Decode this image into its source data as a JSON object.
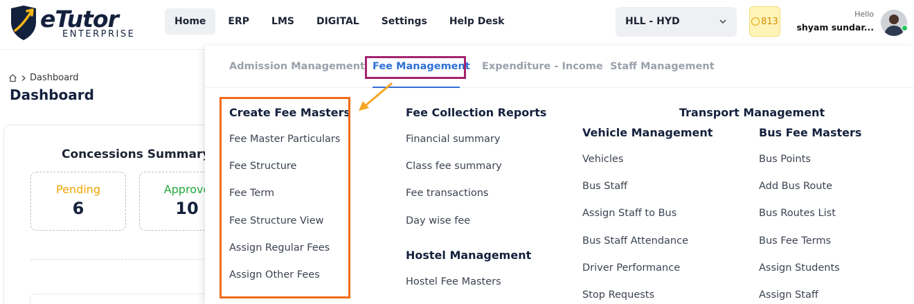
{
  "header": {
    "logo_text": "eTutor",
    "logo_sub": "ENTERPRISE",
    "nav": [
      {
        "label": "Home",
        "active": true
      },
      {
        "label": "ERP",
        "active": false
      },
      {
        "label": "LMS",
        "active": false
      },
      {
        "label": "DIGITAL",
        "active": false
      },
      {
        "label": "Settings",
        "active": false
      },
      {
        "label": "Help Desk",
        "active": false
      }
    ],
    "branch": "HLL - HYD",
    "coins": "813",
    "greeting": "Hello",
    "user_name": "shyam sundar..."
  },
  "page": {
    "breadcrumb": "Dashboard",
    "title": "Dashboard",
    "card_title": "Concessions Summary",
    "stats": [
      {
        "label": "Pending",
        "value": "6",
        "color": "#f0a500"
      },
      {
        "label": "Approve",
        "value": "10",
        "color": "#22a83a"
      }
    ]
  },
  "menu": {
    "tabs": [
      "Admission Management",
      "Fee Management",
      "Expenditure - Income",
      "Staff Management"
    ],
    "active_tab": "Fee Management",
    "col1": {
      "heading": "Create Fee Masters",
      "links": [
        "Fee Master Particulars",
        "Fee Structure",
        "Fee Term",
        "Fee Structure View",
        "Assign Regular Fees",
        "Assign Other Fees"
      ]
    },
    "col2": {
      "heading": "Fee Collection Reports",
      "links": [
        "Financial summary",
        "Class fee summary",
        "Fee transactions",
        "Day wise fee"
      ],
      "heading2": "Hostel Management",
      "links2": [
        "Hostel Fee Masters"
      ]
    },
    "transport": {
      "heading": "Transport Management",
      "vehicle": {
        "heading": "Vehicle Management",
        "links": [
          "Vehicles",
          "Bus Staff",
          "Assign Staff to Bus",
          "Bus Staff Attendance",
          "Driver Performance",
          "Stop Requests"
        ]
      },
      "bus": {
        "heading": "Bus Fee Masters",
        "links": [
          "Bus Points",
          "Add Bus Route",
          "Bus Routes List",
          "Bus Fee Terms",
          "Assign Students",
          "Assign Staff"
        ]
      }
    }
  },
  "colors": {
    "accent": "#2f6fd6",
    "highlight_tab": "#a3236f",
    "highlight_box": "#f26a1b",
    "arrow": "#f5a623"
  }
}
